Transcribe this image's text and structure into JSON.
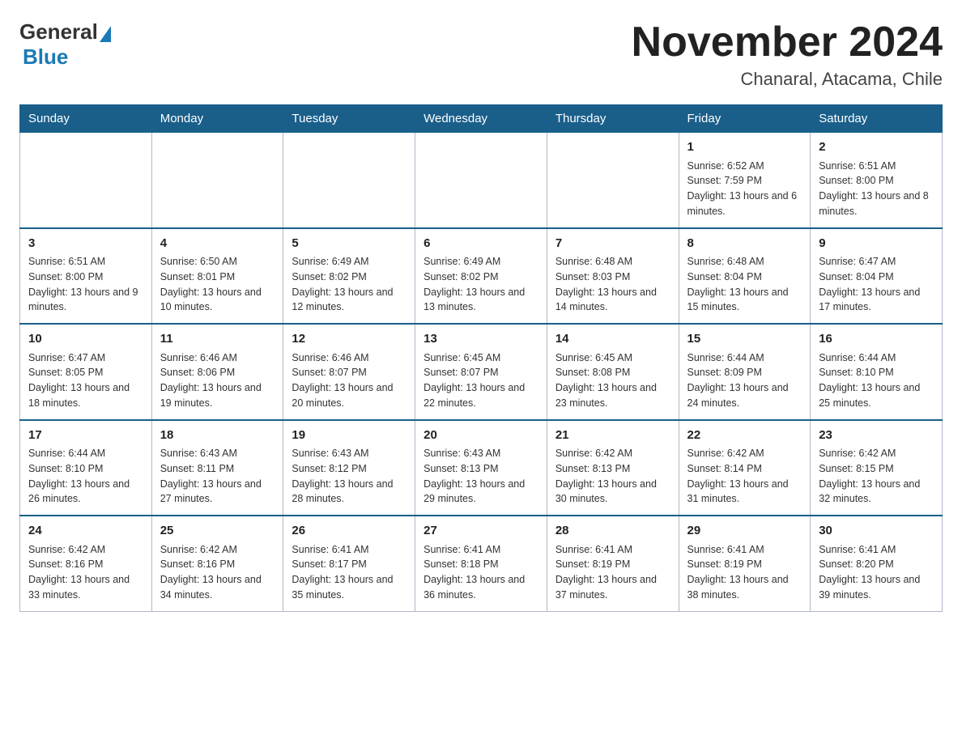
{
  "logo": {
    "general": "General",
    "blue": "Blue",
    "subtitle": "Blue"
  },
  "title": "November 2024",
  "subtitle": "Chanaral, Atacama, Chile",
  "days_of_week": [
    "Sunday",
    "Monday",
    "Tuesday",
    "Wednesday",
    "Thursday",
    "Friday",
    "Saturday"
  ],
  "weeks": [
    [
      {
        "day": "",
        "sunrise": "",
        "sunset": "",
        "daylight": ""
      },
      {
        "day": "",
        "sunrise": "",
        "sunset": "",
        "daylight": ""
      },
      {
        "day": "",
        "sunrise": "",
        "sunset": "",
        "daylight": ""
      },
      {
        "day": "",
        "sunrise": "",
        "sunset": "",
        "daylight": ""
      },
      {
        "day": "",
        "sunrise": "",
        "sunset": "",
        "daylight": ""
      },
      {
        "day": "1",
        "sunrise": "Sunrise: 6:52 AM",
        "sunset": "Sunset: 7:59 PM",
        "daylight": "Daylight: 13 hours and 6 minutes."
      },
      {
        "day": "2",
        "sunrise": "Sunrise: 6:51 AM",
        "sunset": "Sunset: 8:00 PM",
        "daylight": "Daylight: 13 hours and 8 minutes."
      }
    ],
    [
      {
        "day": "3",
        "sunrise": "Sunrise: 6:51 AM",
        "sunset": "Sunset: 8:00 PM",
        "daylight": "Daylight: 13 hours and 9 minutes."
      },
      {
        "day": "4",
        "sunrise": "Sunrise: 6:50 AM",
        "sunset": "Sunset: 8:01 PM",
        "daylight": "Daylight: 13 hours and 10 minutes."
      },
      {
        "day": "5",
        "sunrise": "Sunrise: 6:49 AM",
        "sunset": "Sunset: 8:02 PM",
        "daylight": "Daylight: 13 hours and 12 minutes."
      },
      {
        "day": "6",
        "sunrise": "Sunrise: 6:49 AM",
        "sunset": "Sunset: 8:02 PM",
        "daylight": "Daylight: 13 hours and 13 minutes."
      },
      {
        "day": "7",
        "sunrise": "Sunrise: 6:48 AM",
        "sunset": "Sunset: 8:03 PM",
        "daylight": "Daylight: 13 hours and 14 minutes."
      },
      {
        "day": "8",
        "sunrise": "Sunrise: 6:48 AM",
        "sunset": "Sunset: 8:04 PM",
        "daylight": "Daylight: 13 hours and 15 minutes."
      },
      {
        "day": "9",
        "sunrise": "Sunrise: 6:47 AM",
        "sunset": "Sunset: 8:04 PM",
        "daylight": "Daylight: 13 hours and 17 minutes."
      }
    ],
    [
      {
        "day": "10",
        "sunrise": "Sunrise: 6:47 AM",
        "sunset": "Sunset: 8:05 PM",
        "daylight": "Daylight: 13 hours and 18 minutes."
      },
      {
        "day": "11",
        "sunrise": "Sunrise: 6:46 AM",
        "sunset": "Sunset: 8:06 PM",
        "daylight": "Daylight: 13 hours and 19 minutes."
      },
      {
        "day": "12",
        "sunrise": "Sunrise: 6:46 AM",
        "sunset": "Sunset: 8:07 PM",
        "daylight": "Daylight: 13 hours and 20 minutes."
      },
      {
        "day": "13",
        "sunrise": "Sunrise: 6:45 AM",
        "sunset": "Sunset: 8:07 PM",
        "daylight": "Daylight: 13 hours and 22 minutes."
      },
      {
        "day": "14",
        "sunrise": "Sunrise: 6:45 AM",
        "sunset": "Sunset: 8:08 PM",
        "daylight": "Daylight: 13 hours and 23 minutes."
      },
      {
        "day": "15",
        "sunrise": "Sunrise: 6:44 AM",
        "sunset": "Sunset: 8:09 PM",
        "daylight": "Daylight: 13 hours and 24 minutes."
      },
      {
        "day": "16",
        "sunrise": "Sunrise: 6:44 AM",
        "sunset": "Sunset: 8:10 PM",
        "daylight": "Daylight: 13 hours and 25 minutes."
      }
    ],
    [
      {
        "day": "17",
        "sunrise": "Sunrise: 6:44 AM",
        "sunset": "Sunset: 8:10 PM",
        "daylight": "Daylight: 13 hours and 26 minutes."
      },
      {
        "day": "18",
        "sunrise": "Sunrise: 6:43 AM",
        "sunset": "Sunset: 8:11 PM",
        "daylight": "Daylight: 13 hours and 27 minutes."
      },
      {
        "day": "19",
        "sunrise": "Sunrise: 6:43 AM",
        "sunset": "Sunset: 8:12 PM",
        "daylight": "Daylight: 13 hours and 28 minutes."
      },
      {
        "day": "20",
        "sunrise": "Sunrise: 6:43 AM",
        "sunset": "Sunset: 8:13 PM",
        "daylight": "Daylight: 13 hours and 29 minutes."
      },
      {
        "day": "21",
        "sunrise": "Sunrise: 6:42 AM",
        "sunset": "Sunset: 8:13 PM",
        "daylight": "Daylight: 13 hours and 30 minutes."
      },
      {
        "day": "22",
        "sunrise": "Sunrise: 6:42 AM",
        "sunset": "Sunset: 8:14 PM",
        "daylight": "Daylight: 13 hours and 31 minutes."
      },
      {
        "day": "23",
        "sunrise": "Sunrise: 6:42 AM",
        "sunset": "Sunset: 8:15 PM",
        "daylight": "Daylight: 13 hours and 32 minutes."
      }
    ],
    [
      {
        "day": "24",
        "sunrise": "Sunrise: 6:42 AM",
        "sunset": "Sunset: 8:16 PM",
        "daylight": "Daylight: 13 hours and 33 minutes."
      },
      {
        "day": "25",
        "sunrise": "Sunrise: 6:42 AM",
        "sunset": "Sunset: 8:16 PM",
        "daylight": "Daylight: 13 hours and 34 minutes."
      },
      {
        "day": "26",
        "sunrise": "Sunrise: 6:41 AM",
        "sunset": "Sunset: 8:17 PM",
        "daylight": "Daylight: 13 hours and 35 minutes."
      },
      {
        "day": "27",
        "sunrise": "Sunrise: 6:41 AM",
        "sunset": "Sunset: 8:18 PM",
        "daylight": "Daylight: 13 hours and 36 minutes."
      },
      {
        "day": "28",
        "sunrise": "Sunrise: 6:41 AM",
        "sunset": "Sunset: 8:19 PM",
        "daylight": "Daylight: 13 hours and 37 minutes."
      },
      {
        "day": "29",
        "sunrise": "Sunrise: 6:41 AM",
        "sunset": "Sunset: 8:19 PM",
        "daylight": "Daylight: 13 hours and 38 minutes."
      },
      {
        "day": "30",
        "sunrise": "Sunrise: 6:41 AM",
        "sunset": "Sunset: 8:20 PM",
        "daylight": "Daylight: 13 hours and 39 minutes."
      }
    ]
  ]
}
